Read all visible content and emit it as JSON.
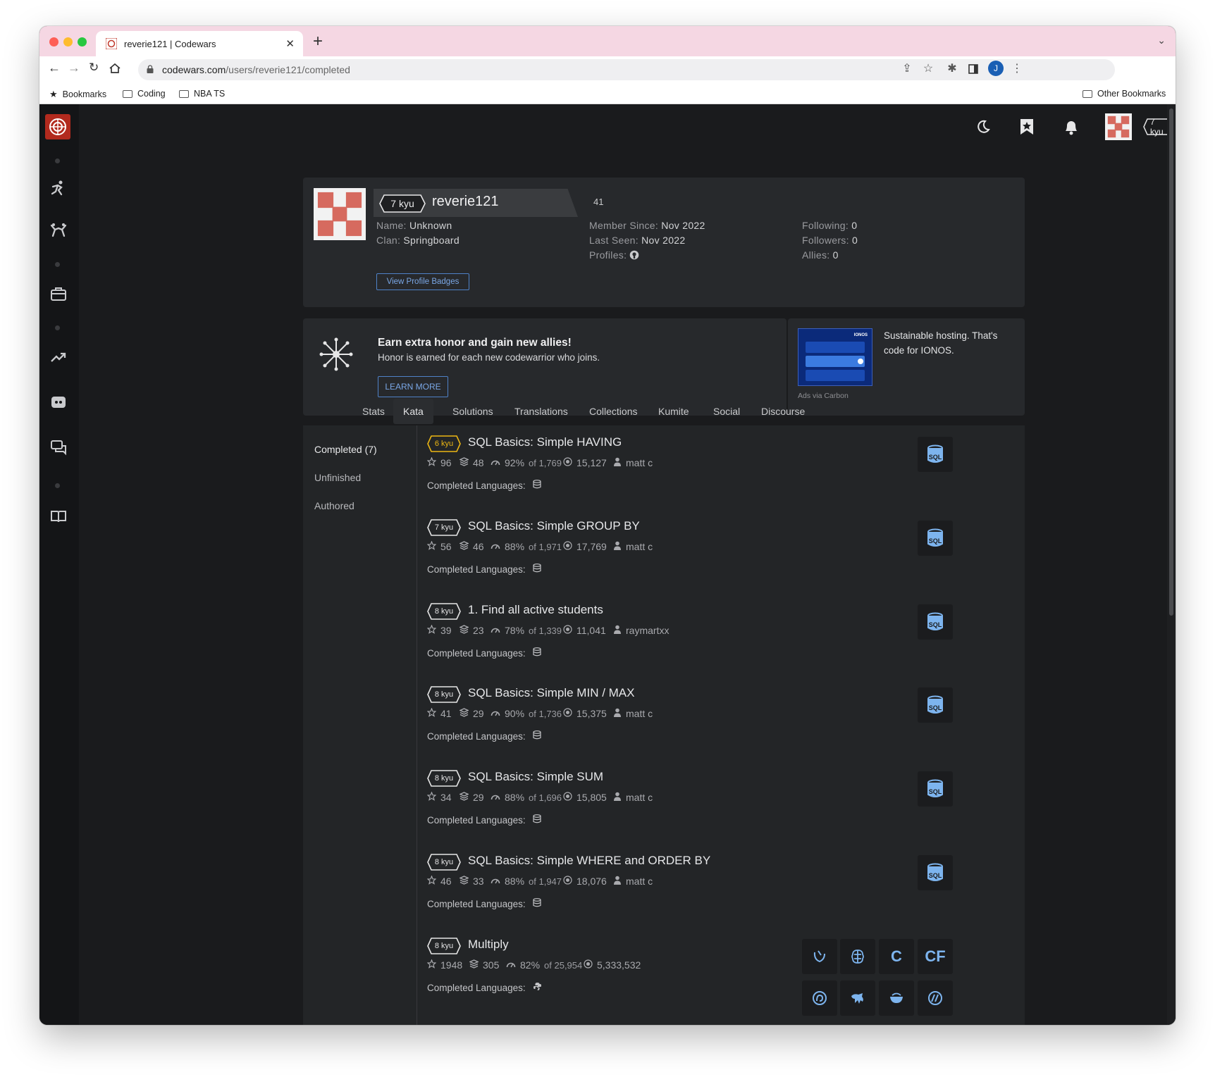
{
  "browser": {
    "tab_title": "reverie121 | Codewars",
    "url_host": "codewars.com",
    "url_path": "/users/reverie121/completed",
    "bookmarks": [
      "Bookmarks",
      "Coding",
      "NBA TS"
    ],
    "other_bookmarks": "Other Bookmarks",
    "profile_initial": "J"
  },
  "header": {
    "rank": "7 kyu",
    "honor": "41"
  },
  "profile": {
    "rank": "7 kyu",
    "username": "reverie121",
    "honor": "41",
    "name_label": "Name:",
    "name_value": "Unknown",
    "clan_label": "Clan:",
    "clan_value": "Springboard",
    "member_since_label": "Member Since:",
    "member_since_value": "Nov 2022",
    "last_seen_label": "Last Seen:",
    "last_seen_value": "Nov 2022",
    "profiles_label": "Profiles:",
    "following_label": "Following:",
    "following_value": "0",
    "followers_label": "Followers:",
    "followers_value": "0",
    "allies_label": "Allies:",
    "allies_value": "0",
    "badges_button": "View Profile Badges"
  },
  "promo": {
    "title": "Earn extra honor and gain new allies!",
    "text": "Honor is earned for each new codewarrior who joins.",
    "button": "LEARN MORE"
  },
  "ad": {
    "text": "Sustainable hosting. That's code for IONOS.",
    "via": "Ads via Carbon",
    "brand": "IONOS"
  },
  "tabs": [
    "Stats",
    "Kata",
    "Solutions",
    "Translations",
    "Collections",
    "Kumite",
    "Social",
    "Discourse"
  ],
  "subnav": [
    "Completed (7)",
    "Unfinished",
    "Authored"
  ],
  "completed_label": "Completed Languages:",
  "katas": [
    {
      "kyu": "6 kyu",
      "title": "SQL Basics: Simple HAVING",
      "stars": "96",
      "collections": "48",
      "satisfaction": "92%",
      "votes": "of 1,769",
      "completed": "15,127",
      "author": "matt c"
    },
    {
      "kyu": "7 kyu",
      "title": "SQL Basics: Simple GROUP BY",
      "stars": "56",
      "collections": "46",
      "satisfaction": "88%",
      "votes": "of 1,971",
      "completed": "17,769",
      "author": "matt c"
    },
    {
      "kyu": "8 kyu",
      "title": "1. Find all active students",
      "stars": "39",
      "collections": "23",
      "satisfaction": "78%",
      "votes": "of 1,339",
      "completed": "11,041",
      "author": "raymartxx"
    },
    {
      "kyu": "8 kyu",
      "title": "SQL Basics: Simple MIN / MAX",
      "stars": "41",
      "collections": "29",
      "satisfaction": "90%",
      "votes": "of 1,736",
      "completed": "15,375",
      "author": "matt c"
    },
    {
      "kyu": "8 kyu",
      "title": "SQL Basics: Simple SUM",
      "stars": "34",
      "collections": "29",
      "satisfaction": "88%",
      "votes": "of 1,696",
      "completed": "15,805",
      "author": "matt c"
    },
    {
      "kyu": "8 kyu",
      "title": "SQL Basics: Simple WHERE and ORDER BY",
      "stars": "46",
      "collections": "33",
      "satisfaction": "88%",
      "votes": "of 1,947",
      "completed": "18,076",
      "author": "matt c"
    },
    {
      "kyu": "8 kyu",
      "title": "Multiply",
      "stars": "1948",
      "collections": "305",
      "satisfaction": "82%",
      "votes": "of 25,954",
      "completed": "5,333,532",
      "author": ""
    }
  ],
  "multiply_lang_icons": [
    "C",
    "CF"
  ],
  "colors": {
    "kyu6": "#ecb613",
    "kyu_default": "#e6e6e6",
    "sql_blue": "#7db4ee",
    "link_blue": "#4f82c8",
    "logo_red": "#b22a1e"
  }
}
